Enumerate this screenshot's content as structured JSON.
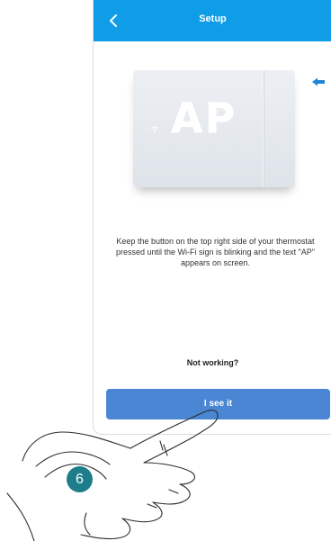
{
  "header": {
    "title": "Setup",
    "back_icon": "chevron-left-icon"
  },
  "thermostat": {
    "display_text": "AP",
    "wifi_icon": "wifi-icon",
    "button_indicator_icon": "arrow-left-icon"
  },
  "instructions": {
    "text": "Keep the button on the top right side of your thermostat pressed until the Wi-Fi sign is blinking and the text \"AP\" appears on screen."
  },
  "links": {
    "not_working": "Not working?"
  },
  "actions": {
    "primary_label": "I see it"
  },
  "step_indicator": {
    "number": "6"
  },
  "colors": {
    "header": "#0f9de8",
    "primary_button": "#4a86d3",
    "step_badge": "#1e7d8a"
  }
}
